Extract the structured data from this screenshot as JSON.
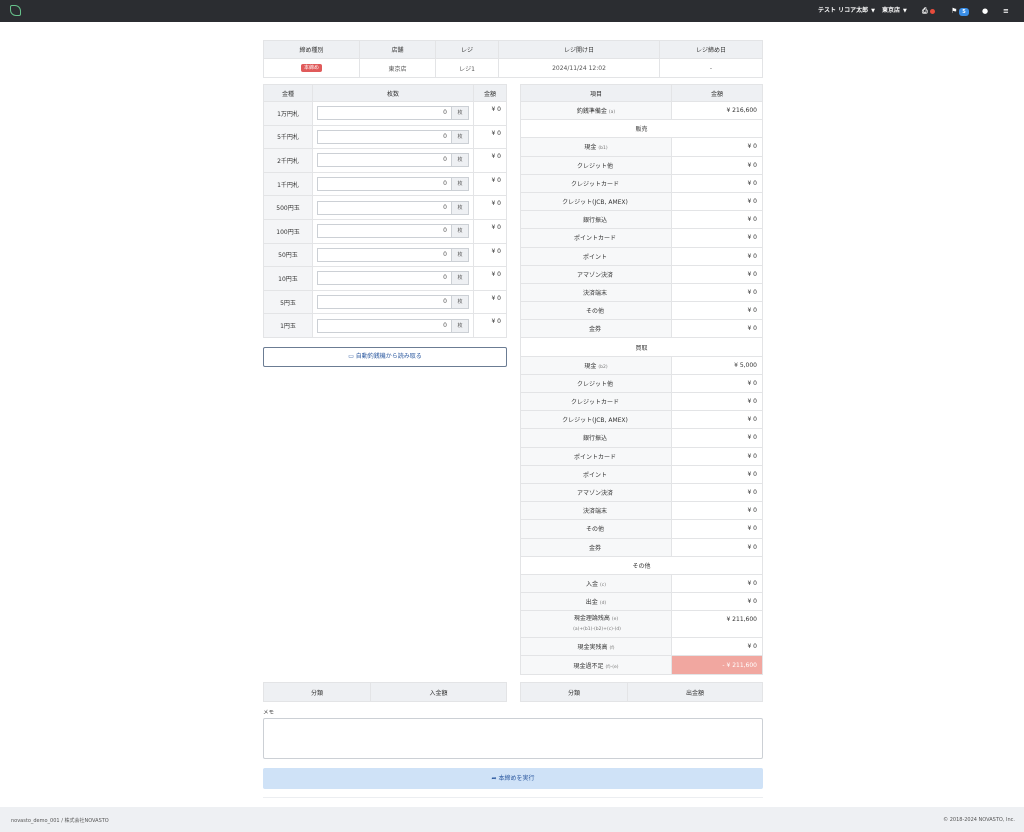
{
  "nav": {
    "user": "テスト リコア太郎",
    "store": "東京店",
    "flag_count": "5"
  },
  "info": {
    "headers": [
      "締め種別",
      "店舗",
      "レジ",
      "レジ開け日",
      "レジ締め日"
    ],
    "type_badge": "本締め",
    "store": "東京店",
    "register": "レジ1",
    "opened": "2024/11/24 12:02",
    "closed": "-"
  },
  "denom": {
    "headers": [
      "金種",
      "枚数",
      "金額"
    ],
    "unit": "枚",
    "rows": [
      {
        "label": "1万円札",
        "qty": "0",
        "amount": "¥ 0"
      },
      {
        "label": "5千円札",
        "qty": "0",
        "amount": "¥ 0"
      },
      {
        "label": "2千円札",
        "qty": "0",
        "amount": "¥ 0"
      },
      {
        "label": "1千円札",
        "qty": "0",
        "amount": "¥ 0"
      },
      {
        "label": "500円玉",
        "qty": "0",
        "amount": "¥ 0"
      },
      {
        "label": "100円玉",
        "qty": "0",
        "amount": "¥ 0"
      },
      {
        "label": "50円玉",
        "qty": "0",
        "amount": "¥ 0"
      },
      {
        "label": "10円玉",
        "qty": "0",
        "amount": "¥ 0"
      },
      {
        "label": "5円玉",
        "qty": "0",
        "amount": "¥ 0"
      },
      {
        "label": "1円玉",
        "qty": "0",
        "amount": "¥ 0"
      }
    ],
    "read_button": "自動釣銭機から読み取る"
  },
  "summary": {
    "headers": [
      "項目",
      "金額"
    ],
    "reserve": {
      "label": "釣銭準備金",
      "sub": "(a)",
      "value": "¥ 216,600"
    },
    "sales_title": "販売",
    "purchase_title": "買取",
    "other_title": "その他",
    "sales": [
      {
        "label": "現金",
        "sub": "(b1)",
        "value": "¥ 0"
      },
      {
        "label": "クレジット他",
        "sub": "",
        "value": "¥ 0"
      },
      {
        "label": "クレジットカード",
        "sub": "",
        "value": "¥ 0"
      },
      {
        "label": "クレジット(JCB, AMEX)",
        "sub": "",
        "value": "¥ 0"
      },
      {
        "label": "銀行振込",
        "sub": "",
        "value": "¥ 0"
      },
      {
        "label": "ポイントカード",
        "sub": "",
        "value": "¥ 0"
      },
      {
        "label": "ポイント",
        "sub": "",
        "value": "¥ 0"
      },
      {
        "label": "アマゾン決済",
        "sub": "",
        "value": "¥ 0"
      },
      {
        "label": "決済端末",
        "sub": "",
        "value": "¥ 0"
      },
      {
        "label": "その他",
        "sub": "",
        "value": "¥ 0"
      },
      {
        "label": "金券",
        "sub": "",
        "value": "¥ 0"
      }
    ],
    "purchase": [
      {
        "label": "現金",
        "sub": "(b2)",
        "value": "¥ 5,000"
      },
      {
        "label": "クレジット他",
        "sub": "",
        "value": "¥ 0"
      },
      {
        "label": "クレジットカード",
        "sub": "",
        "value": "¥ 0"
      },
      {
        "label": "クレジット(JCB, AMEX)",
        "sub": "",
        "value": "¥ 0"
      },
      {
        "label": "銀行振込",
        "sub": "",
        "value": "¥ 0"
      },
      {
        "label": "ポイントカード",
        "sub": "",
        "value": "¥ 0"
      },
      {
        "label": "ポイント",
        "sub": "",
        "value": "¥ 0"
      },
      {
        "label": "アマゾン決済",
        "sub": "",
        "value": "¥ 0"
      },
      {
        "label": "決済端末",
        "sub": "",
        "value": "¥ 0"
      },
      {
        "label": "その他",
        "sub": "",
        "value": "¥ 0"
      },
      {
        "label": "金券",
        "sub": "",
        "value": "¥ 0"
      }
    ],
    "deposit": {
      "label": "入金",
      "sub": "(c)",
      "value": "¥ 0"
    },
    "withdraw": {
      "label": "出金",
      "sub": "(d)",
      "value": "¥ 0"
    },
    "theory": {
      "label": "現金理論残高",
      "sub": "(e)",
      "formula": "(a)+(b1)-(b2)+(c)-(d)",
      "value": "¥ 211,600"
    },
    "actual": {
      "label": "現金実残高",
      "sub": "(f)",
      "value": "¥ 0"
    },
    "diff": {
      "label": "現金過不足",
      "sub": "(f)-(e)",
      "value": "- ¥ 211,600"
    }
  },
  "deposit_table": {
    "headers": [
      "分類",
      "入金額"
    ]
  },
  "withdraw_table": {
    "headers": [
      "分類",
      "出金額"
    ]
  },
  "memo_label": "メモ",
  "run_button": "本締めを実行",
  "footer": {
    "left": "novasto_demo_001 / 株式会社NOVASTO",
    "right": "© 2018-2024 NOVASTO, Inc."
  }
}
